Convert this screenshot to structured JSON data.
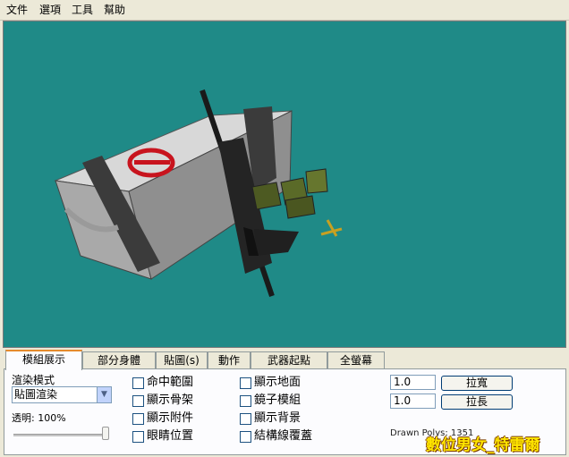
{
  "menu": [
    "文件",
    "選項",
    "工具",
    "幫助"
  ],
  "tabs": [
    "模組展示",
    "部分身體",
    "貼圖(s)",
    "動作",
    "武器起點",
    "全螢幕"
  ],
  "active_tab": 0,
  "render_mode": {
    "label": "渲染模式",
    "selected": "貼圖渲染"
  },
  "transparency_label": "透明: 100%",
  "transparency_value_percent": 100,
  "checkboxes_col1": [
    "命中範圍",
    "顯示骨架",
    "顯示附件",
    "眼睛位置"
  ],
  "checkboxes_col2": [
    "顯示地面",
    "鏡子模組",
    "顯示背景",
    "結構線覆蓋"
  ],
  "scale_rows": [
    {
      "value": "1.0",
      "button": "拉寬"
    },
    {
      "value": "1.0",
      "button": "拉長"
    }
  ],
  "drawn_polys": "Drawn Polys: 1351",
  "watermark": "數位男女_特雷爾",
  "colors": {
    "viewport_bg": "#1f8a87",
    "tab_accent": "#e68b2c",
    "watermark": "#ffe600"
  }
}
